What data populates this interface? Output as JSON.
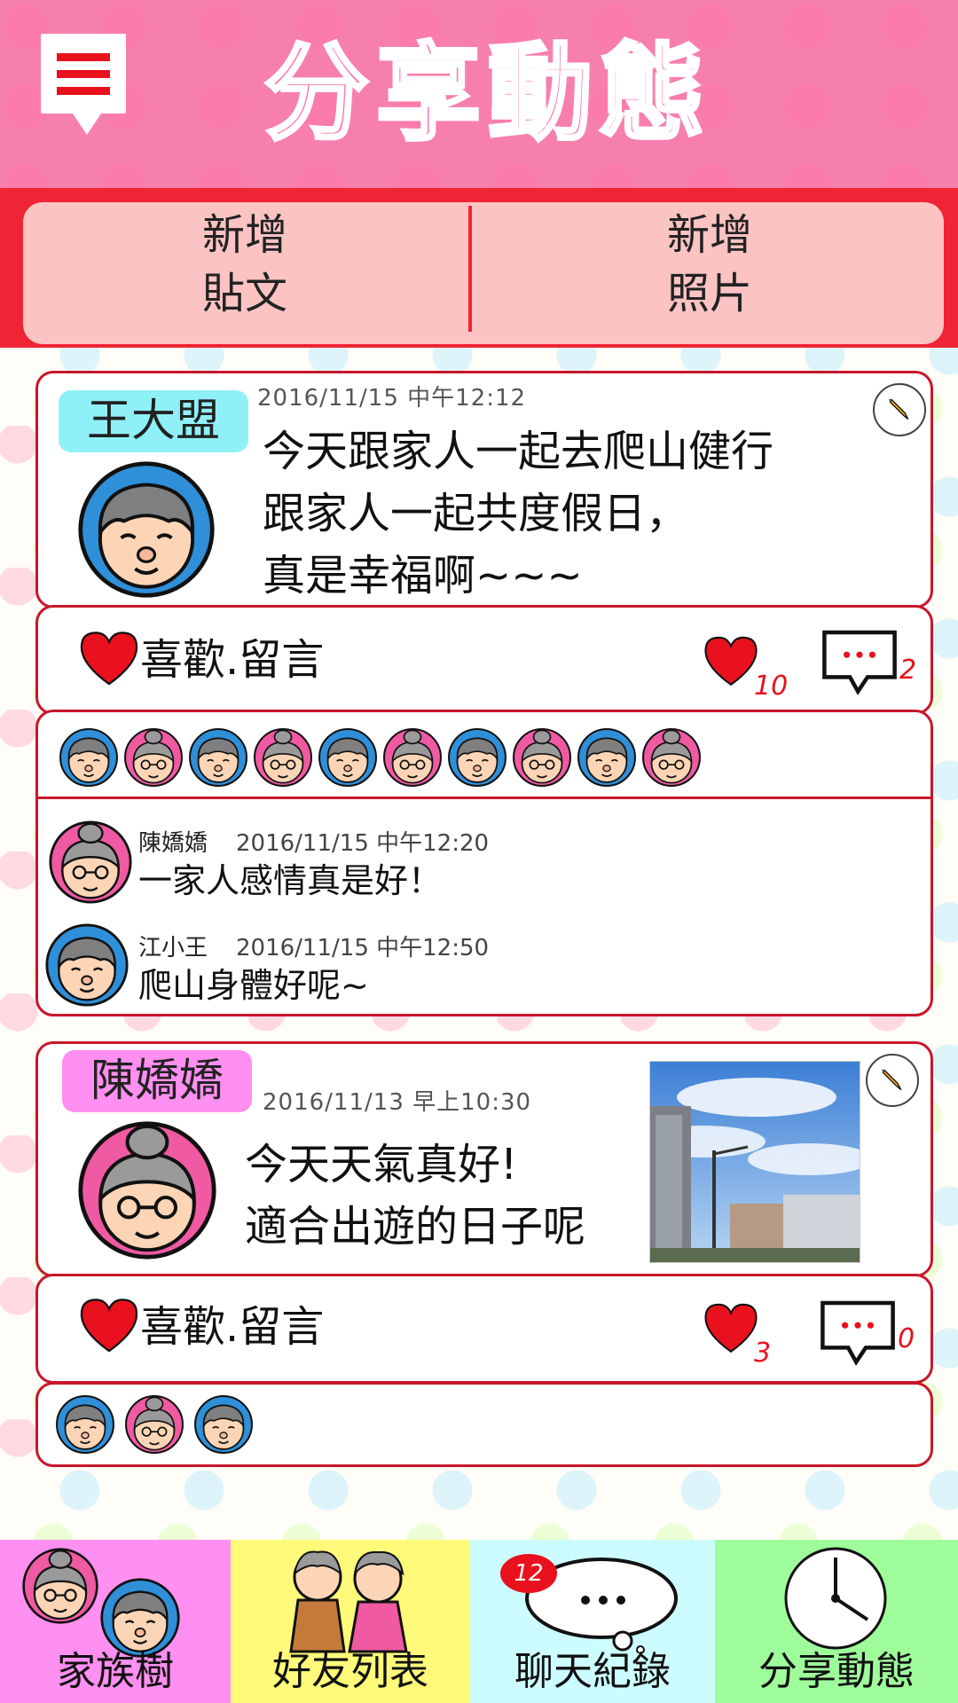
{
  "header": {
    "title": "分享動態"
  },
  "actions": {
    "new_post": {
      "line1": "新增",
      "line2": "貼文"
    },
    "new_photo": {
      "line1": "新增",
      "line2": "照片"
    }
  },
  "posts": [
    {
      "author": "王大盟",
      "timestamp": "2016/11/15 中午12:12",
      "text_lines": [
        "今天跟家人一起去爬山健行",
        "跟家人一起共度假日，",
        "真是幸福啊~~~"
      ],
      "like_label": "喜歡.留言",
      "like_count": "10",
      "comment_count": "2",
      "likers_count": 10,
      "comments": [
        {
          "name": "陳嬌嬌",
          "time": "2016/11/15 中午12:20",
          "text": "一家人感情真是好！"
        },
        {
          "name": "江小王",
          "time": "2016/11/15 中午12:50",
          "text": "爬山身體好呢~"
        }
      ]
    },
    {
      "author": "陳嬌嬌",
      "timestamp": "2016/11/13 早上10:30",
      "text_lines": [
        "今天天氣真好!",
        "適合出遊的日子呢"
      ],
      "like_label": "喜歡.留言",
      "like_count": "3",
      "comment_count": "0",
      "likers_count": 3
    }
  ],
  "nav": {
    "family_tree": "家族樹",
    "friends": "好友列表",
    "chat": "聊天紀錄",
    "chat_badge": "12",
    "share": "分享動態"
  },
  "colors": {
    "header_bg": "#f77fae",
    "accent_red": "#ef2434",
    "nav_family": "#ff8ff0",
    "nav_friends": "#fffa7a",
    "nav_chat": "#ccfcff",
    "nav_share": "#9ffc9b"
  }
}
